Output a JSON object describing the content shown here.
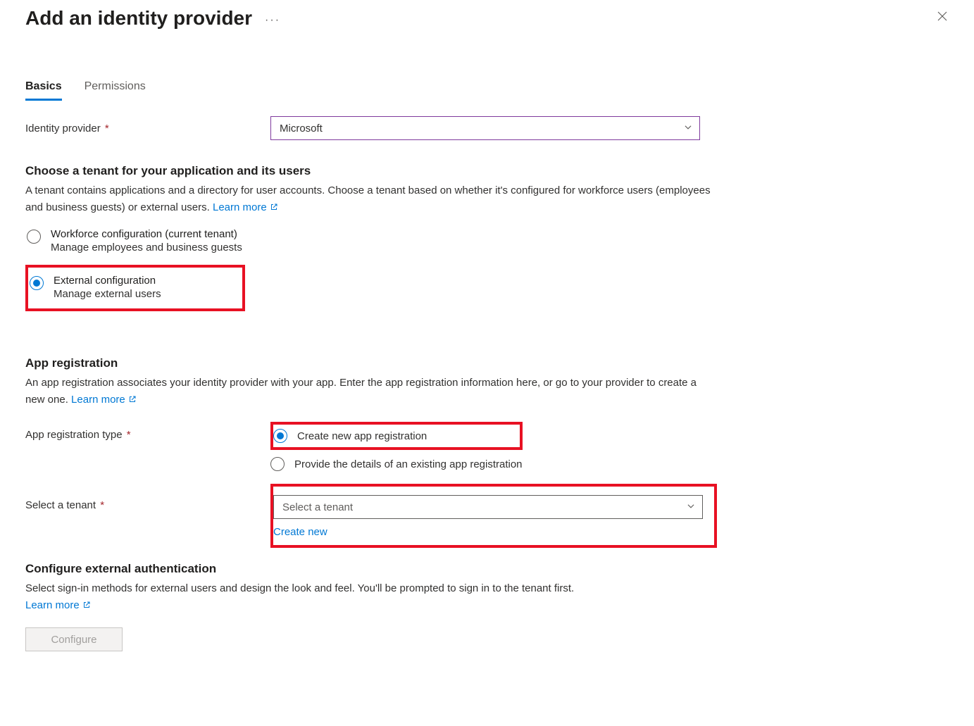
{
  "header": {
    "title": "Add an identity provider"
  },
  "tabs": {
    "basics": "Basics",
    "permissions": "Permissions"
  },
  "identityProvider": {
    "label": "Identity provider",
    "value": "Microsoft"
  },
  "tenantSection": {
    "heading": "Choose a tenant for your application and its users",
    "desc_part1": "A tenant contains applications and a directory for user accounts. Choose a tenant based on whether it's configured for workforce users (employees and business guests) or external users. ",
    "learn_more": "Learn more",
    "radio_workforce": {
      "label": "Workforce configuration (current tenant)",
      "sub": "Manage employees and business guests"
    },
    "radio_external": {
      "label": "External configuration",
      "sub": "Manage external users"
    }
  },
  "appReg": {
    "heading": "App registration",
    "desc_part1": "An app registration associates your identity provider with your app. Enter the app registration information here, or go to your provider to create a new one. ",
    "learn_more": "Learn more",
    "type_label": "App registration type",
    "radio_create": "Create new app registration",
    "radio_existing": "Provide the details of an existing app registration",
    "select_label": "Select a tenant",
    "select_placeholder": "Select a tenant",
    "create_new": "Create new"
  },
  "externalAuth": {
    "heading": "Configure external authentication",
    "desc_part1": "Select sign-in methods for external users and design the look and feel. You'll be prompted to sign in to the tenant first. ",
    "learn_more": "Learn more",
    "configure_btn": "Configure"
  }
}
